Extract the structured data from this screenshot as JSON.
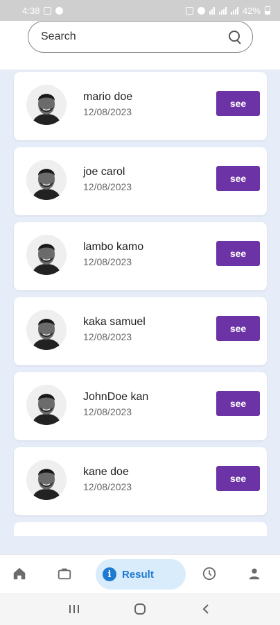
{
  "status_bar": {
    "time": "4:38",
    "battery_text": "42%"
  },
  "search": {
    "placeholder": "Search"
  },
  "items": [
    {
      "name": "mario doe",
      "date": "12/08/2023",
      "button_label": "see"
    },
    {
      "name": "joe carol",
      "date": "12/08/2023",
      "button_label": "see"
    },
    {
      "name": "lambo kamo",
      "date": "12/08/2023",
      "button_label": "see"
    },
    {
      "name": "kaka samuel",
      "date": "12/08/2023",
      "button_label": "see"
    },
    {
      "name": "JohnDoe kan",
      "date": "12/08/2023",
      "button_label": "see"
    },
    {
      "name": "kane doe",
      "date": "12/08/2023",
      "button_label": "see"
    }
  ],
  "bottom_nav": {
    "items": [
      {
        "icon": "home-icon"
      },
      {
        "icon": "briefcase-icon"
      },
      {
        "icon": "info-icon",
        "label": "Result",
        "active": true
      },
      {
        "icon": "clock-icon"
      },
      {
        "icon": "person-icon"
      }
    ]
  },
  "colors": {
    "accent": "#6c33a6",
    "active_nav_bg": "#d8ecfb",
    "active_nav_fg": "#1e7ad1",
    "list_bg": "#e6edf9"
  }
}
